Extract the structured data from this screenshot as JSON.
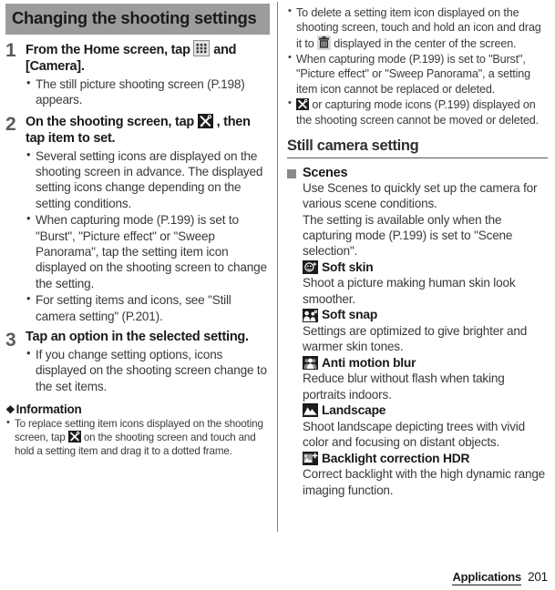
{
  "document": {
    "section_title": "Changing the shooting settings",
    "footer_label": "Applications",
    "page_number": "201"
  },
  "left_column": {
    "steps": [
      {
        "number": "1",
        "title_before_icon": "From the Home screen, tap",
        "icon": "app-drawer-icon",
        "title_after_icon": "and [Camera].",
        "bullets": [
          "The still picture shooting screen (P.198) appears."
        ]
      },
      {
        "number": "2",
        "title_before_icon": "On the shooting screen, tap",
        "icon": "tools-icon",
        "title_after_icon": ", then tap item to set.",
        "bullets": [
          "Several setting icons are displayed on the shooting screen in advance. The displayed setting icons change depending on the setting conditions.",
          "When capturing mode (P.199) is set to \"Burst\", \"Picture effect\" or \"Sweep Panorama\", tap the setting item icon displayed on the shooting screen to change the setting.",
          "For setting items and icons, see \"Still camera setting\" (P.201)."
        ]
      },
      {
        "number": "3",
        "title_before_icon": "Tap an option in the selected setting.",
        "icon": "",
        "title_after_icon": "",
        "bullets": [
          "If you change setting options, icons displayed on the shooting screen change to the set items."
        ]
      }
    ],
    "information": {
      "heading": "Information",
      "items": [
        {
          "text_before_icon": "To replace setting item icons displayed on the shooting screen, tap",
          "icon": "tools-icon",
          "text_after_icon": "on the shooting screen and touch and hold a setting item and drag it to a dotted frame."
        }
      ]
    }
  },
  "right_column": {
    "top_bullets": [
      {
        "text_before_icon": "To delete a setting item icon displayed on the shooting screen, touch and hold an icon and drag it to",
        "icon": "trash-icon",
        "text_after_icon": "displayed in the center of the screen."
      },
      {
        "text_before_icon": "When capturing mode (P.199) is set to \"Burst\", \"Picture effect\" or \"Sweep Panorama\", a setting item icon cannot be replaced or deleted.",
        "icon": "",
        "text_after_icon": ""
      },
      {
        "text_before_icon": "",
        "icon": "tools-icon",
        "text_after_icon": "or capturing mode icons (P.199) displayed on the shooting screen cannot be moved or deleted."
      }
    ],
    "heading": "Still camera setting",
    "subsection": {
      "marker": "square-marker",
      "title": "Scenes",
      "intro_lines": [
        "Use Scenes to quickly set up the camera for various scene conditions.",
        "The setting is available only when the capturing mode (P.199) is set to \"Scene selection\"."
      ],
      "scenes": [
        {
          "icon": "soft-skin-icon",
          "name": "Soft skin",
          "description": "Shoot a picture making human skin look smoother."
        },
        {
          "icon": "soft-snap-icon",
          "name": "Soft snap",
          "description": "Settings are optimized to give brighter and warmer skin tones."
        },
        {
          "icon": "anti-motion-blur-icon",
          "name": "Anti motion blur",
          "description": "Reduce blur without flash when taking portraits indoors."
        },
        {
          "icon": "landscape-icon",
          "name": "Landscape",
          "description": "Shoot landscape depicting trees with vivid color and focusing on distant objects."
        },
        {
          "icon": "backlight-hdr-icon",
          "name": "Backlight correction HDR",
          "description": "Correct backlight with the high dynamic range imaging function."
        }
      ]
    }
  },
  "colors": {
    "banner_bg": "#9c9c9c",
    "text": "#3a3a3a",
    "heading": "#1a1a1a",
    "marker": "#8a8a8a"
  }
}
